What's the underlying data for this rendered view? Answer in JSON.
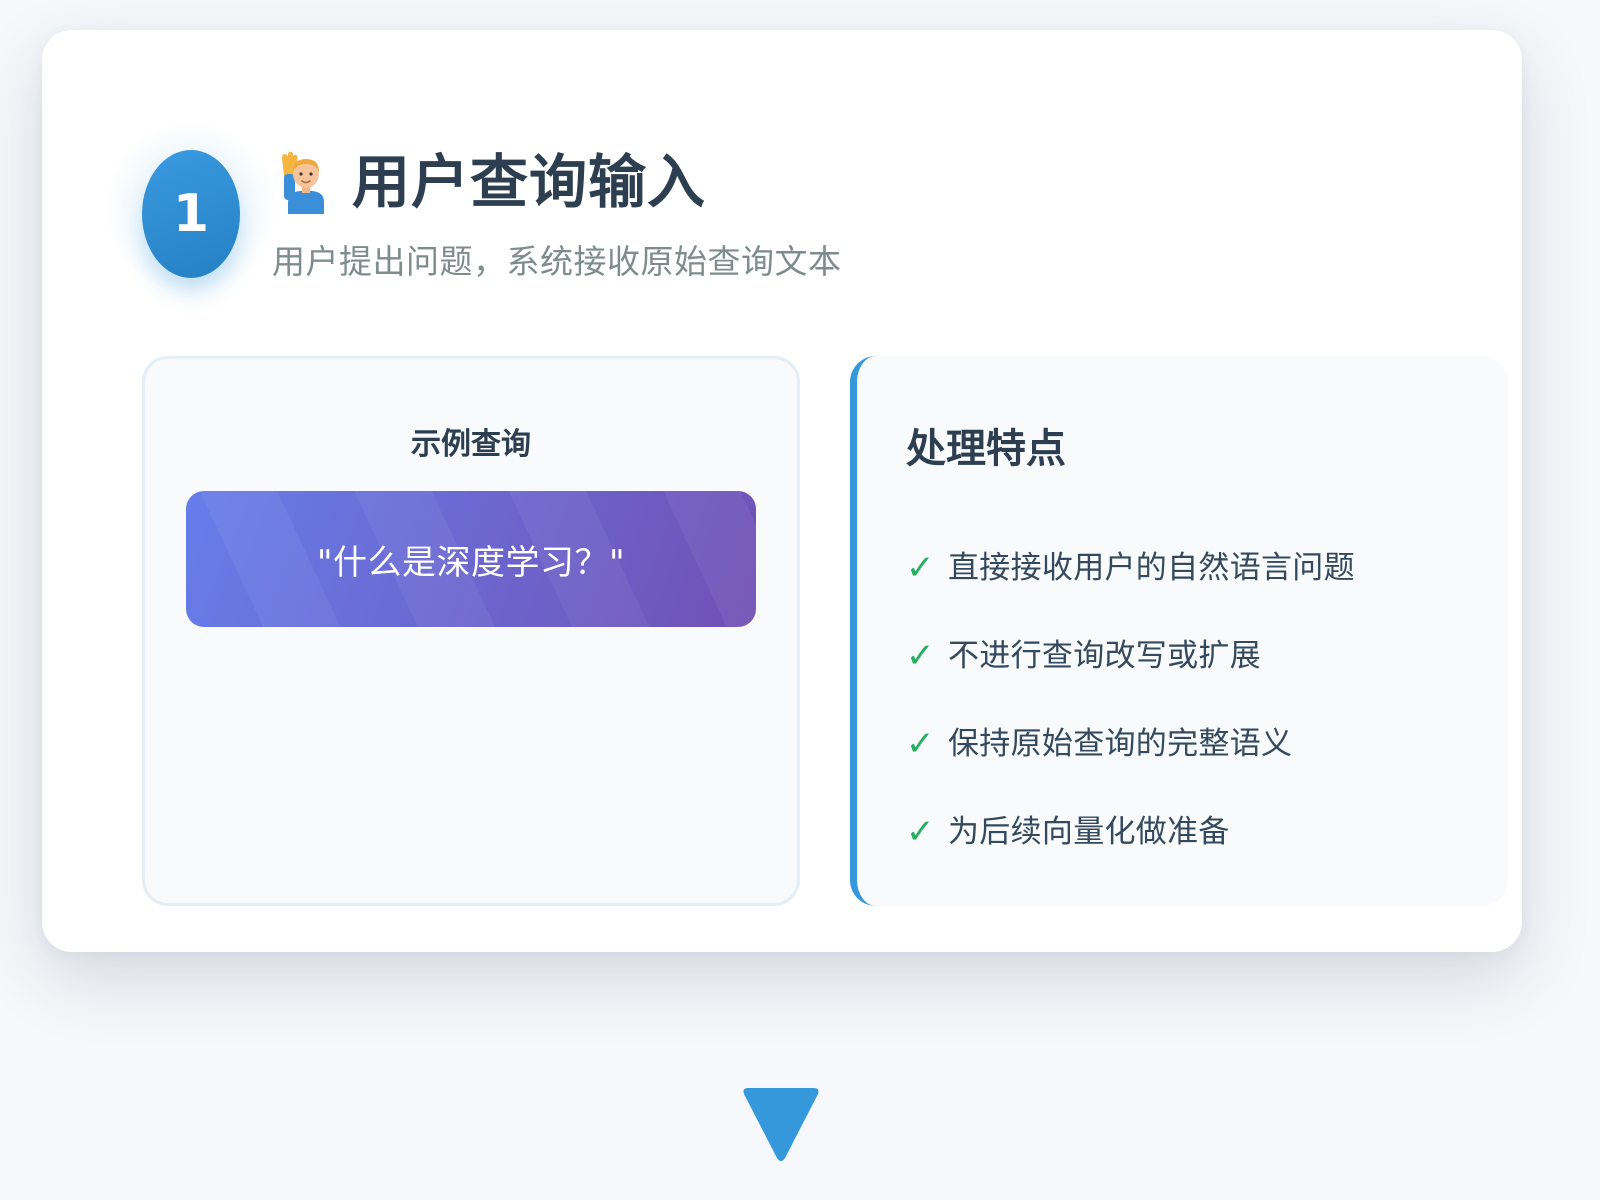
{
  "step": {
    "number": "1",
    "icon": "person-raising-hand-icon",
    "title": "用户查询输入",
    "subtitle": "用户提出问题，系统接收原始查询文本"
  },
  "example": {
    "title": "示例查询",
    "query": "\"什么是深度学习？\""
  },
  "features": {
    "title": "处理特点",
    "check_icon": "check-icon",
    "items": [
      {
        "text": "直接接收用户的自然语言问题"
      },
      {
        "text": "不进行查询改写或扩展"
      },
      {
        "text": "保持原始查询的完整语义"
      },
      {
        "text": "为后续向量化做准备"
      }
    ]
  },
  "next_indicator": {
    "icon": "triangle-down-icon"
  },
  "colors": {
    "accent": "#3498db",
    "query_gradient_start": "#667eea",
    "query_gradient_end": "#764ba2",
    "check": "#27ae60",
    "title_text": "#2c3e50",
    "subtitle_text": "#7f8c8d"
  }
}
